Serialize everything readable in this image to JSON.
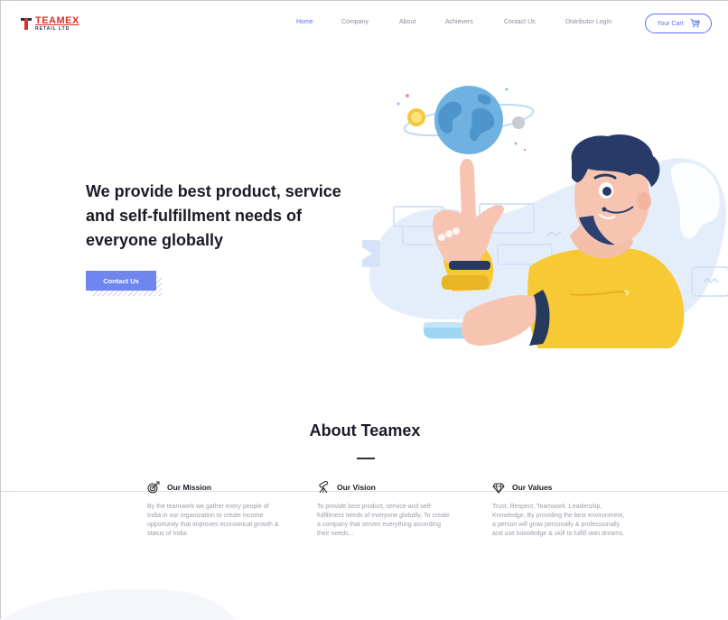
{
  "brand": {
    "name": "TEAMEX",
    "subtitle": "RETAIL LTD"
  },
  "nav": {
    "items": [
      {
        "label": "Home",
        "active": true
      },
      {
        "label": "Company",
        "active": false
      },
      {
        "label": "About",
        "active": false
      },
      {
        "label": "Achievers",
        "active": false
      },
      {
        "label": "Contact Us",
        "active": false
      },
      {
        "label": "Distributor Login",
        "active": false
      }
    ],
    "cart_label": "Your Cart"
  },
  "hero": {
    "title": "We provide best product, service and self-fulfillment needs of everyone globally",
    "cta_label": "Contact Us"
  },
  "about": {
    "title": "About Teamex",
    "cards": [
      {
        "icon": "target-icon",
        "title": "Our Mission",
        "text": "By the teamwork we gather every people of India in our organization to create income opportunity that improves economical growth & status of India."
      },
      {
        "icon": "telescope-icon",
        "title": "Our Vision",
        "text": "To provide best product, service and self-fulfillment needs of everyone globally, To create a company that serves everything according their needs..."
      },
      {
        "icon": "diamond-icon",
        "title": "Our Values",
        "text": "Trust, Respect, Teamwork, Leadership, Knowledge, By providing the best environment, a person will grow personally & professionally and use knowledge & skill to fulfill own dreams."
      }
    ]
  },
  "colors": {
    "accent": "#5b73e8",
    "button": "#6e86ee",
    "brand_red": "#d9322a",
    "brand_navy": "#2a2f4a"
  }
}
